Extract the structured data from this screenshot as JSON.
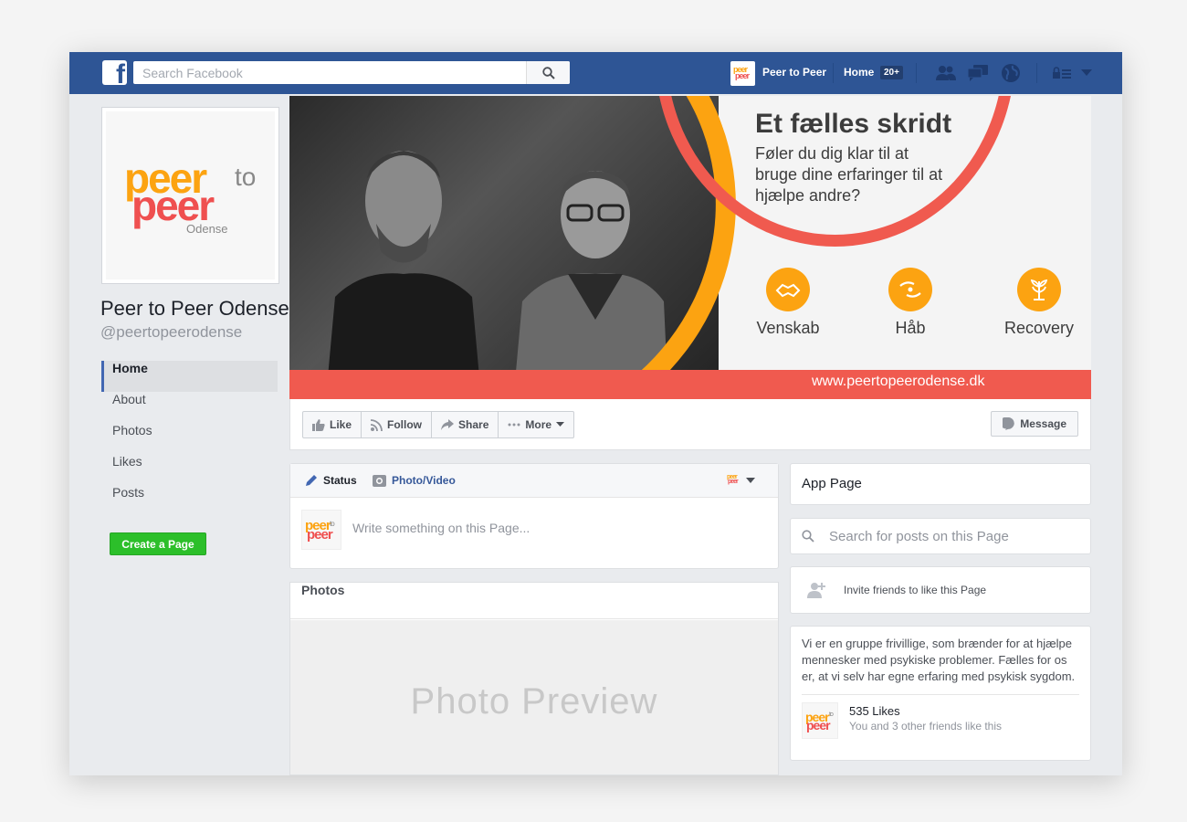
{
  "topbar": {
    "logo": "f",
    "search_placeholder": "Search Facebook",
    "page_name": "Peer to Peer",
    "home_label": "Home",
    "home_badge": "20+"
  },
  "profile": {
    "logo_peer": "peer",
    "logo_to": "to",
    "logo_odense": "Odense",
    "name": "Peer to Peer Odense",
    "handle": "@peertopeerodense"
  },
  "sidebar": {
    "items": [
      {
        "label": "Home"
      },
      {
        "label": "About"
      },
      {
        "label": "Photos"
      },
      {
        "label": "Likes"
      },
      {
        "label": "Posts"
      }
    ],
    "create_label": "Create a Page"
  },
  "cover": {
    "title": "Et fælles skridt",
    "subtitle": "Føler du dig klar til at bruge dine erfaringer til at hjælpe andre?",
    "badges": [
      {
        "label": "Venskab"
      },
      {
        "label": "Håb"
      },
      {
        "label": "Recovery"
      }
    ],
    "url": "www.peertopeerodense.dk"
  },
  "actions": {
    "like": "Like",
    "follow": "Follow",
    "share": "Share",
    "more": "More",
    "message": "Message"
  },
  "composer": {
    "status_tab": "Status",
    "photo_tab": "Photo/Video",
    "placeholder": "Write something on this Page..."
  },
  "photos": {
    "title": "Photos",
    "preview": "Photo Preview"
  },
  "right": {
    "app_page": "App Page",
    "search_placeholder": "Search for posts on this Page",
    "invite": "Invite friends to like this Page",
    "about": "Vi er en gruppe frivillige, som brænder for at hjælpe mennesker med psykiske problemer. Fælles for os er, at vi selv har egne erfaring med psykisk sygdom.",
    "likes": "535 Likes",
    "friends": "You and 3 other friends like this"
  },
  "colors": {
    "brand_blue": "#2e5595",
    "orange": "#fca311",
    "red": "#f05a4f",
    "green": "#2cbf2a"
  }
}
